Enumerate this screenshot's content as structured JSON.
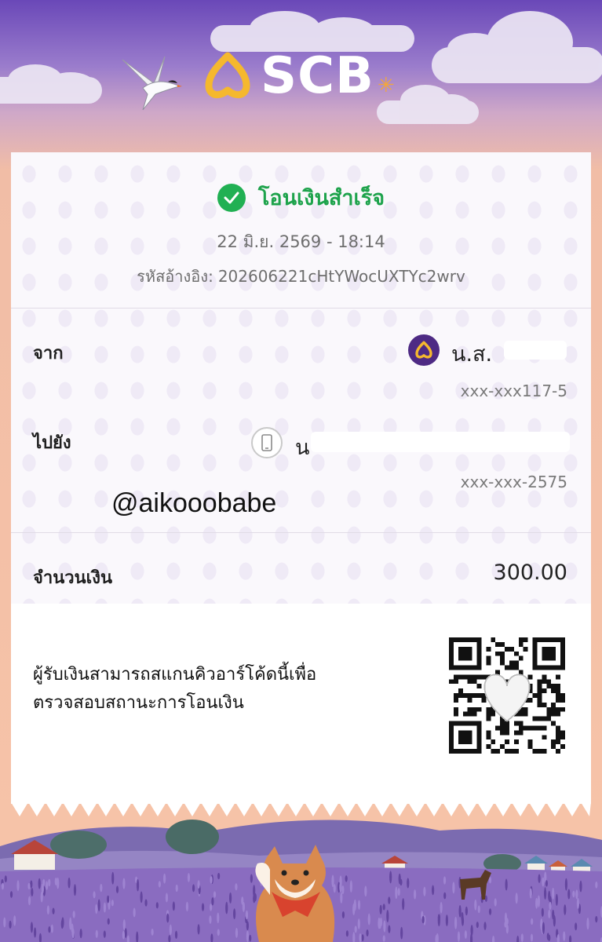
{
  "brand": {
    "name": "SCB",
    "accent": "#f5b82e",
    "purple": "#4e2a84"
  },
  "status": {
    "text": "โอนเงินสำเร็จ",
    "color": "#1ea34c"
  },
  "datetime": "22 มิ.ย. 2569 - 18:14",
  "reference": {
    "label": "รหัสอ้างอิง:",
    "value": "202606221cHtYWocUXTYc2wrv"
  },
  "from": {
    "label": "จาก",
    "name": "น.ส.",
    "account": "xxx-xxx117-5"
  },
  "to": {
    "label": "ไปยัง",
    "name": "น",
    "account": "xxx-xxx-2575"
  },
  "handle": "@aikooobabe",
  "amount": {
    "label": "จำนวนเงิน",
    "value": "300.00"
  },
  "qr_note": {
    "line1": "ผู้รับเงินสามารถสแกนคิวอาร์โค้ดนี้เพื่อ",
    "line2": "ตรวจสอบสถานะการโอนเงิน"
  }
}
